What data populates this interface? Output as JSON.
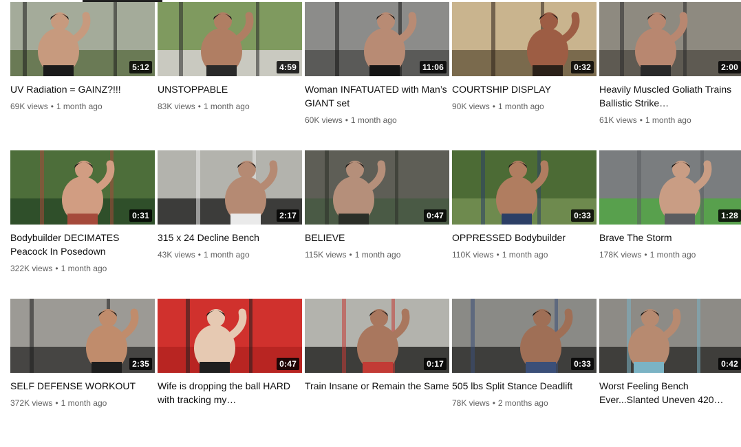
{
  "videos": [
    {
      "title": "UV Radiation = GAINZ?!!!",
      "views": "69K views",
      "age": "1 month ago",
      "duration": "5:12",
      "colors": {
        "bg": "#a4ab9a",
        "mid": "#6a7a55",
        "fg": "#c79a7e",
        "accent": "#1b1b1b"
      }
    },
    {
      "title": "UNSTOPPABLE",
      "views": "83K views",
      "age": "1 month ago",
      "duration": "4:59",
      "colors": {
        "bg": "#7f9a5f",
        "mid": "#c9c9c0",
        "fg": "#b07e63",
        "accent": "#2a2a2a"
      }
    },
    {
      "title": "Woman INFATUATED with Man’s GIANT set",
      "views": "60K views",
      "age": "1 month ago",
      "duration": "11:06",
      "colors": {
        "bg": "#8c8c8a",
        "mid": "#5a5a58",
        "fg": "#b88b74",
        "accent": "#151515"
      }
    },
    {
      "title": "COURTSHIP DISPLAY",
      "views": "90K views",
      "age": "1 month ago",
      "duration": "0:32",
      "colors": {
        "bg": "#c9b48e",
        "mid": "#7a6a4d",
        "fg": "#9d5d44",
        "accent": "#2b2119"
      }
    },
    {
      "title": "Heavily Muscled Goliath Trains Ballistic Strike…",
      "views": "61K views",
      "age": "1 month ago",
      "duration": "2:00",
      "colors": {
        "bg": "#8e8a80",
        "mid": "#5e5a52",
        "fg": "#b88770",
        "accent": "#2a2a2a"
      }
    },
    {
      "title": "Bodybuilder DECIMATES Peacock In Posedown",
      "views": "322K views",
      "age": "1 month ago",
      "duration": "0:31",
      "colors": {
        "bg": "#4d6e3a",
        "mid": "#2f4f2a",
        "fg": "#d19d82",
        "accent": "#a54a3b"
      }
    },
    {
      "title": "315 x 24 Decline Bench",
      "views": "43K views",
      "age": "1 month ago",
      "duration": "2:17",
      "colors": {
        "bg": "#b3b3ad",
        "mid": "#3c3c3a",
        "fg": "#b58a73",
        "accent": "#eaeaea"
      }
    },
    {
      "title": "BELIEVE",
      "views": "115K views",
      "age": "1 month ago",
      "duration": "0:47",
      "colors": {
        "bg": "#5e5e56",
        "mid": "#4a5a45",
        "fg": "#b58f7a",
        "accent": "#2b2f28"
      }
    },
    {
      "title": "OPPRESSED Bodybuilder",
      "views": "110K views",
      "age": "1 month ago",
      "duration": "0:33",
      "colors": {
        "bg": "#4c6b35",
        "mid": "#6e8a4e",
        "fg": "#b07d60",
        "accent": "#2c3f66"
      }
    },
    {
      "title": "Brave The Storm",
      "views": "178K views",
      "age": "1 month ago",
      "duration": "1:28",
      "colors": {
        "bg": "#7a7d7f",
        "mid": "#58a04d",
        "fg": "#c99d84",
        "accent": "#5a5d60"
      }
    },
    {
      "title": "SELF DEFENSE WORKOUT",
      "views": "372K views",
      "age": "1 month ago",
      "duration": "2:35",
      "colors": {
        "bg": "#9c9a95",
        "mid": "#464543",
        "fg": "#c08c6c",
        "accent": "#1e1e1e"
      }
    },
    {
      "title": "Wife is dropping the ball HARD with tracking my…",
      "views": "",
      "age": "",
      "duration": "0:47",
      "colors": {
        "bg": "#d0312d",
        "mid": "#b82522",
        "fg": "#e6c9b2",
        "accent": "#1f1f1f"
      }
    },
    {
      "title": "Train Insane or Remain the Same",
      "views": "",
      "age": "",
      "duration": "0:17",
      "colors": {
        "bg": "#b3b3ad",
        "mid": "#3d3d3a",
        "fg": "#a9775e",
        "accent": "#c23b35"
      }
    },
    {
      "title": "505 lbs Split Stance Deadlift",
      "views": "78K views",
      "age": "2 months ago",
      "duration": "0:33",
      "colors": {
        "bg": "#8a8a86",
        "mid": "#3e3e3c",
        "fg": "#9f6f56",
        "accent": "#3b4f78"
      }
    },
    {
      "title": "Worst Feeling Bench Ever...Slanted Uneven 420…",
      "views": "",
      "age": "",
      "duration": "0:42",
      "colors": {
        "bg": "#8d8b86",
        "mid": "#3f3e3b",
        "fg": "#b78a70",
        "accent": "#7bb3c4"
      }
    }
  ]
}
